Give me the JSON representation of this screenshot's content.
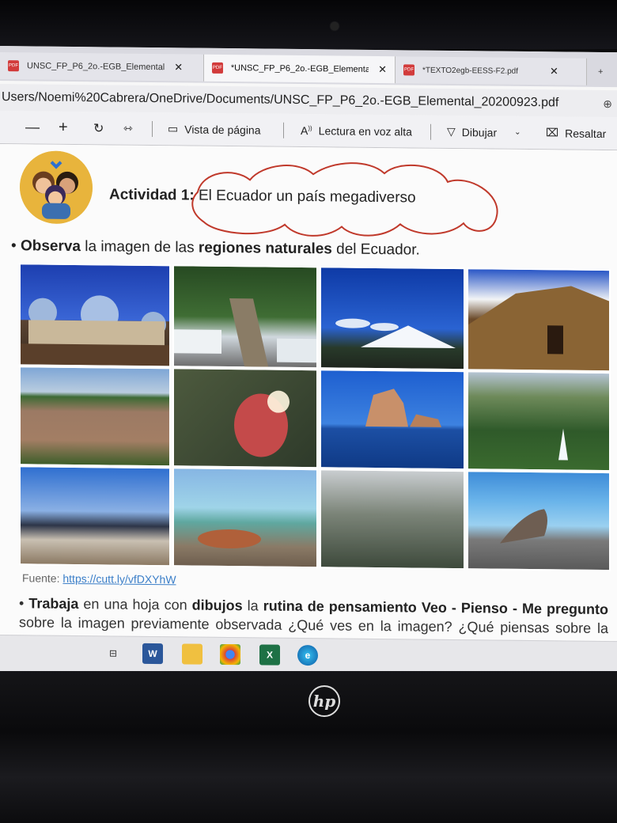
{
  "tabs": [
    {
      "label": "UNSC_FP_P6_2o.-EGB_Elemental",
      "active": false
    },
    {
      "label": "*UNSC_FP_P6_2o.-EGB_Elementa",
      "active": true
    },
    {
      "label": "*TEXTO2egb-EESS-F2.pdf",
      "active": false
    }
  ],
  "address": "Users/Noemi%20Cabrera/OneDrive/Documents/UNSC_FP_P6_2o.-EGB_Elemental_20200923.pdf",
  "toolbar": {
    "minus": "—",
    "plus": "+",
    "view_label": "Vista de página",
    "read_aloud_label": "Lectura en voz alta",
    "draw_label": "Dibujar",
    "highlight_label": "Resaltar"
  },
  "document": {
    "activity_bold": "Actividad",
    "activity_num": "1:",
    "activity_text": "El Ecuador un país megadiverso",
    "bullet1_a": "Observa",
    "bullet1_b": " la imagen de las ",
    "bullet1_c": "regiones naturales",
    "bullet1_d": " del Ecuador.",
    "source_label": "Fuente: ",
    "source_link": "https://cutt.ly/vfDXYhW",
    "para_p1": "Trabaja",
    "para_p2": " en una hoja con ",
    "para_p3": "dibujos",
    "para_p4": " la ",
    "para_p5": "rutina de pensamiento Veo - Pienso - Me pregunto",
    "para_p6": " sobre la imagen previamente observada ¿Qué ves en la imagen? ¿Qué piensas sobre la imagen? Pide a un familiar que te ayude"
  },
  "photos": [
    "cathedral-photo",
    "rope-bridge-photo",
    "volcano-photo",
    "inca-ruins-photo",
    "lagoon-photo",
    "frigatebird-photo",
    "kicker-rock-photo",
    "waterfall-photo",
    "mountain-sky-photo",
    "iguana-photo",
    "misty-forest-photo",
    "sea-lion-photo"
  ],
  "colors": {
    "pdf_red": "#d23b3b",
    "scribble": "#c0392b",
    "link": "#3a7ec8"
  }
}
